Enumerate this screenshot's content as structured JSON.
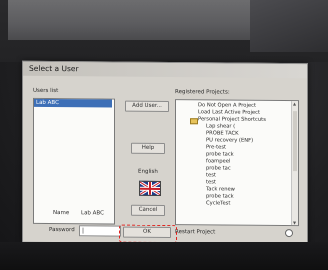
{
  "dialog": {
    "title": "Select a User",
    "users_list_label": "Users list",
    "projects_label": "Registered Projects:",
    "users": [
      "Lab ABC"
    ],
    "selected_user": "Lab ABC",
    "add_user_label": "Add User...",
    "help_label": "Help",
    "language_label": "English",
    "cancel_label": "Cancel",
    "ok_label": "OK",
    "name_label": "Name",
    "name_value": "Lab ABC",
    "password_label": "Password",
    "password_value": "|",
    "restart_label": "Restart Project"
  },
  "projects": {
    "items": [
      "Do Not Open A Project",
      "Load Last Active Project",
      "Personal Project Shortcuts",
      "Lap shear (",
      "PROBE TACK",
      "PU recovery (ENF)",
      "Pre-test",
      "probe tack",
      "foampeel",
      "probe tac",
      "test",
      "test",
      "Tack renew",
      "probe tack",
      "CycleTest"
    ]
  },
  "colors": {
    "selection": "#3d6fb7",
    "highlight_annotation": "#e0231f",
    "dialog_bg": "#d6d3cd"
  }
}
